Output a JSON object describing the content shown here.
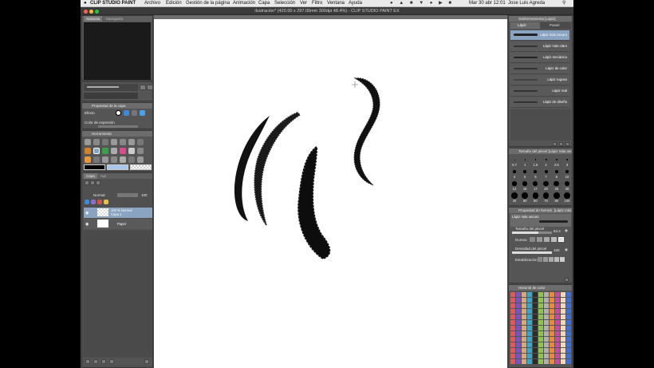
{
  "menubar": {
    "apple": "",
    "app_name": "CLIP STUDIO PAINT",
    "items": [
      "Archivo",
      "Edición",
      "Gestión de la página",
      "Animación",
      "Capa",
      "Selección",
      "Ver",
      "Filtro",
      "Ventana",
      "Ayuda"
    ],
    "clock": "Mar 30 abr  12:01",
    "user": "Jose Luis Agreda"
  },
  "window": {
    "title": "ilustración* (420.00 x 297.00mm 300dpi 48.4%)  - CLIP STUDIO PAINT EX"
  },
  "left": {
    "nav_tabs": [
      "Subvista",
      "Navegador"
    ],
    "layer_property": {
      "header": "Propiedad de la capa",
      "effect_label": "Efecto",
      "expression_color_label": "Color de expresión"
    },
    "tool_header": "Herramienta",
    "layer_panel": {
      "tabs": [
        "Capa",
        "Aut"
      ],
      "blend_mode": "Normal",
      "opacity": "100",
      "layers": [
        {
          "name": "100 % Normal\nCapa 1",
          "selected": true
        },
        {
          "name": "Papel",
          "selected": false
        }
      ]
    }
  },
  "right": {
    "subtool_header": "Subherramienta [Lápiz]",
    "subtool_tabs": [
      "Lápiz",
      "Pastel"
    ],
    "subtools": [
      "Lápiz más oscuro",
      "Lápiz más claro",
      "Lápiz mecánico",
      "Lápiz de color",
      "Lápiz rugoso",
      "Lápiz real",
      "Lápiz de diseño"
    ],
    "brush_size_header": "Tamaño del pincel [Lápiz más osc...",
    "brush_sizes": [
      "0.7",
      "1",
      "1.5",
      "2",
      "2.5",
      "3",
      "4",
      "5",
      "6",
      "7",
      "8",
      "10",
      "12",
      "15",
      "17",
      "20",
      "25",
      "30",
      "40",
      "50",
      "60",
      "70",
      "80",
      "100"
    ],
    "tool_property_header": "Propiedad de herram. [Lápiz más osc...",
    "tool_property_name": "Lápiz más oscuro",
    "props": {
      "brush_size_label": "Tamaño del pincel",
      "brush_size_value": "63.4",
      "hardness_label": "Dureza",
      "density_label": "Densidad del pincel",
      "density_value": "100",
      "stabilization_label": "Estabilización"
    },
    "color_history_header": "Historial de color"
  },
  "colors": {
    "menubar": "#e9e9e9",
    "panel": "#555555",
    "selection": "#8aa3c0",
    "canvas": "#ffffff"
  }
}
